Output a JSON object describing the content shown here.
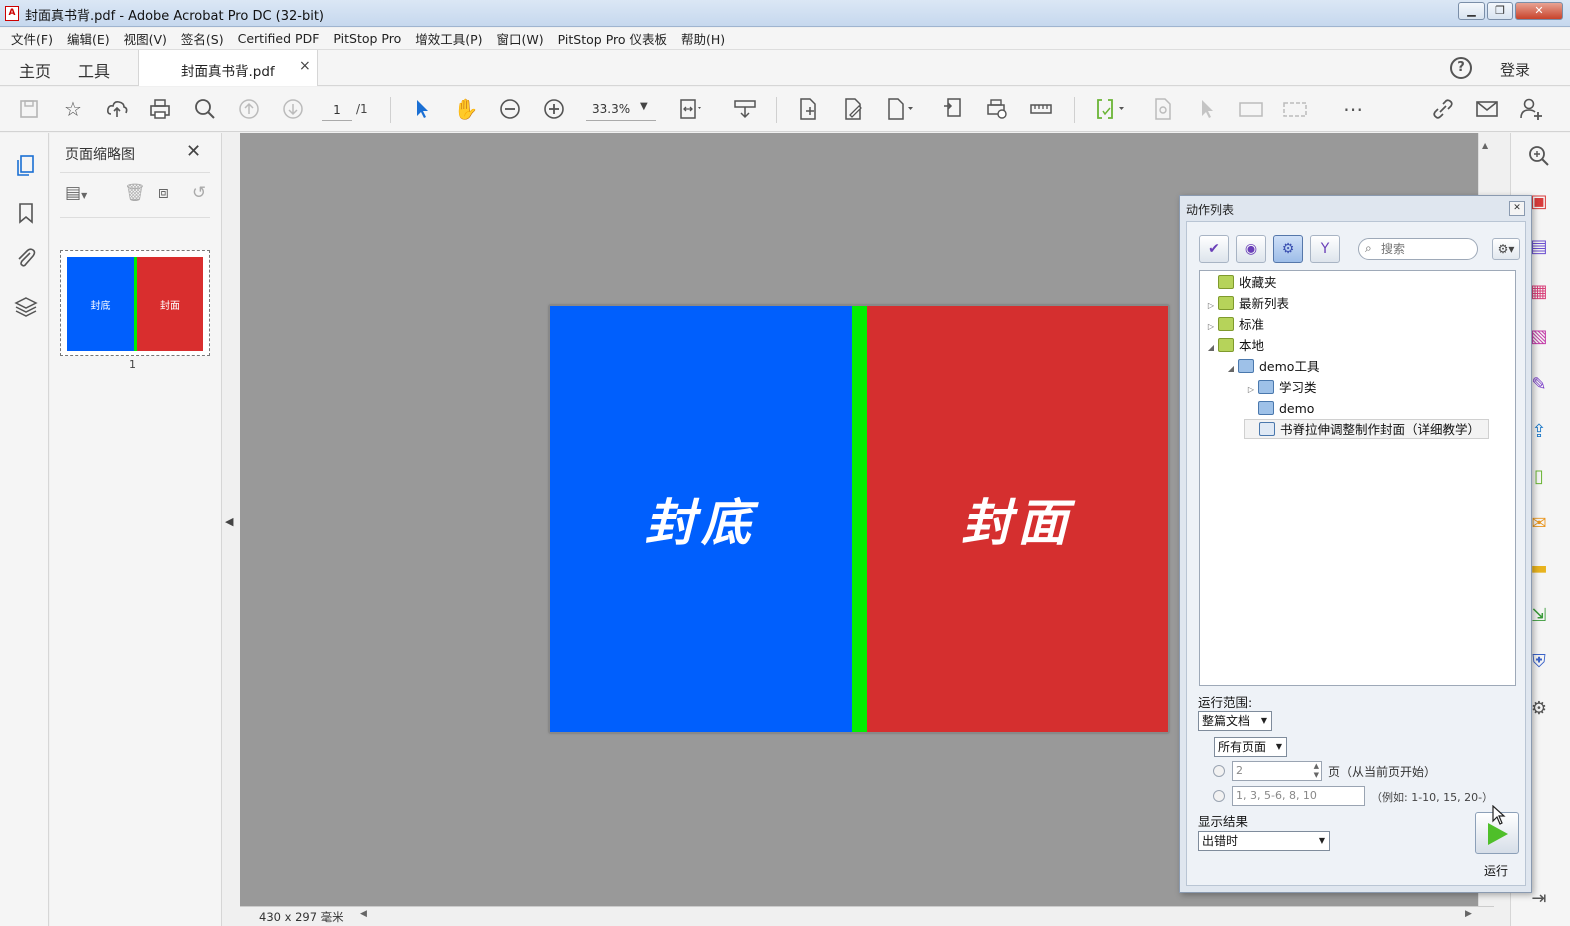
{
  "window": {
    "title": "封面真书背.pdf - Adobe Acrobat Pro DC (32-bit)",
    "app_icon": "pdf-icon",
    "controls": [
      "▁",
      "❐",
      "✕"
    ]
  },
  "menu": [
    "文件(F)",
    "编辑(E)",
    "视图(V)",
    "签名(S)",
    "Certified PDF",
    "PitStop Pro",
    "增效工具(P)",
    "窗口(W)",
    "PitStop Pro 仪表板",
    "帮助(H)"
  ],
  "tabs": {
    "home": "主页",
    "tools": "工具",
    "document": "封面真书背.pdf",
    "close": "×",
    "help": "?",
    "login": "登录"
  },
  "toolbar": {
    "page_current": "1",
    "page_total": "/1",
    "zoom": "33.3%",
    "icons": {
      "save": "save-icon",
      "bookmark": "star-icon",
      "upload": "upload-icon",
      "print": "print-icon",
      "zoom": "search-icon",
      "prev": "arrow-up-icon",
      "next": "arrow-down-icon",
      "select": "select-arrow-icon",
      "hand": "hand-icon",
      "zoom_out": "zoom-out-icon",
      "zoom_in": "zoom-in-icon",
      "more": "more-icon"
    }
  },
  "left_panel": {
    "title": "页面缩略图",
    "thumbnail": {
      "page_number": "1",
      "back_text": "封底",
      "front_text": "封面"
    }
  },
  "document": {
    "back_cover_text": "封底",
    "front_cover_text": "封面",
    "colors": {
      "back": "#005ffd",
      "spine": "#00ee00",
      "front": "#d52f2f"
    },
    "page_size": "430 x 297 毫米"
  },
  "action_list": {
    "title": "动作列表",
    "search_placeholder": "搜索",
    "tree": [
      {
        "label": "收藏夹",
        "expander": "",
        "level": 0,
        "icon": "green"
      },
      {
        "label": "最新列表",
        "expander": "▷",
        "level": 0,
        "icon": "green"
      },
      {
        "label": "标准",
        "expander": "▷",
        "level": 0,
        "icon": "green"
      },
      {
        "label": "本地",
        "expander": "◢",
        "level": 0,
        "icon": "green"
      },
      {
        "label": "demo工具",
        "expander": "◢",
        "level": 1,
        "icon": "blue"
      },
      {
        "label": "学习类",
        "expander": "▷",
        "level": 2,
        "icon": "blue"
      },
      {
        "label": "demo",
        "expander": "",
        "level": 2,
        "icon": "blue"
      },
      {
        "label": "书脊拉伸调整制作封面（详细教学）",
        "expander": "",
        "level": 2,
        "icon": "seq",
        "selected": true
      }
    ],
    "run_scope_label": "运行范围:",
    "run_scope_value": "整篇文档",
    "pages_value": "所有页面",
    "page_count_value": "2",
    "page_count_suffix": "页（从当前页开始）",
    "page_range_value": "1, 3, 5-6, 8, 10",
    "page_range_hint": "（例如: 1-10, 15, 20-）",
    "show_results_label": "显示结果",
    "show_results_value": "出错时",
    "run_label": "运行"
  }
}
